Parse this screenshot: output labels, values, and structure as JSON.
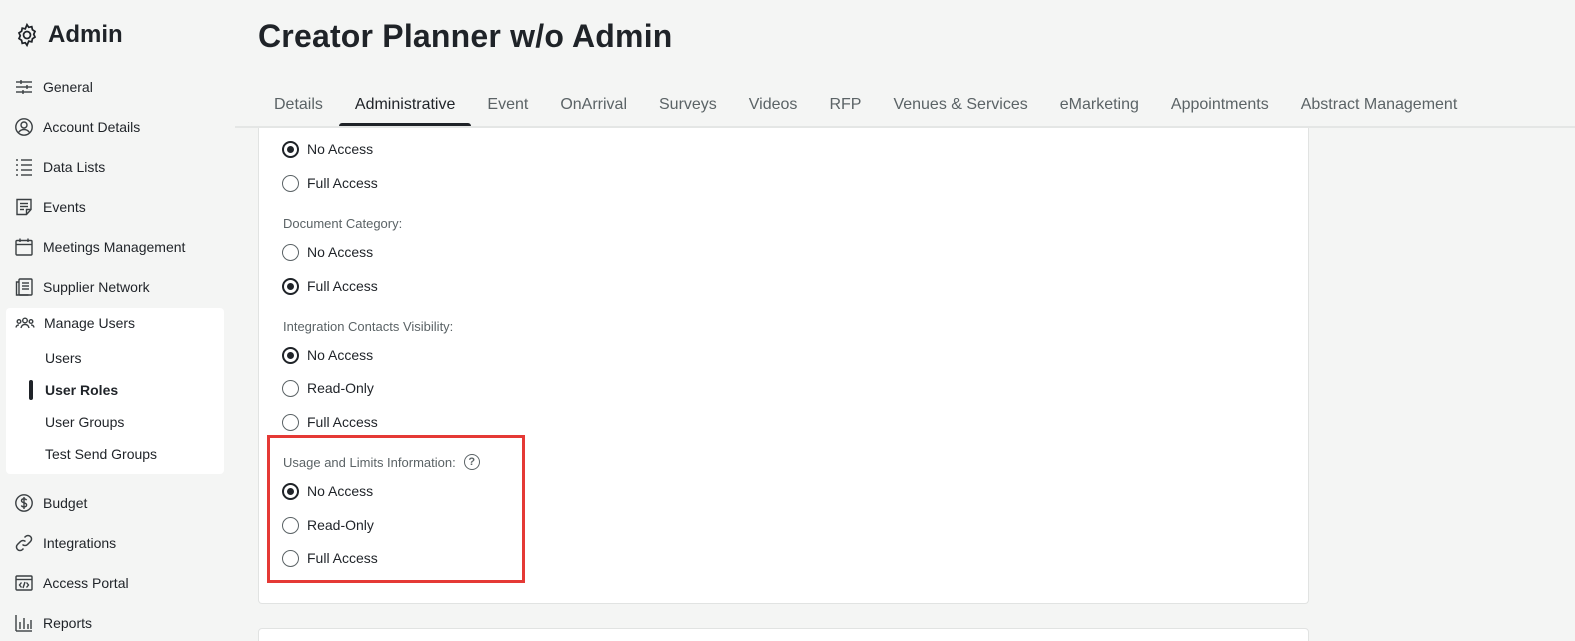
{
  "sidebar": {
    "title": "Admin",
    "items": [
      {
        "label": "General",
        "icon": "sliders-icon"
      },
      {
        "label": "Account Details",
        "icon": "user-circle-icon"
      },
      {
        "label": "Data Lists",
        "icon": "list-icon"
      },
      {
        "label": "Events",
        "icon": "event-note-icon"
      },
      {
        "label": "Meetings Management",
        "icon": "calendar-icon"
      },
      {
        "label": "Supplier Network",
        "icon": "supplier-doc-icon"
      },
      {
        "label": "Manage Users",
        "icon": "users-group-icon"
      },
      {
        "label": "Budget",
        "icon": "dollar-circle-icon"
      },
      {
        "label": "Integrations",
        "icon": "link-icon"
      },
      {
        "label": "Access Portal",
        "icon": "code-window-icon"
      },
      {
        "label": "Reports",
        "icon": "bar-chart-icon"
      }
    ],
    "manage_users_sub": [
      "Users",
      "User Roles",
      "User Groups",
      "Test Send Groups"
    ],
    "active_sub": "User Roles"
  },
  "header": {
    "title": "Creator Planner w/o Admin",
    "tabs": [
      "Details",
      "Administrative",
      "Event",
      "OnArrival",
      "Surveys",
      "Videos",
      "RFP",
      "Venues & Services",
      "eMarketing",
      "Appointments",
      "Abstract Management"
    ],
    "active_tab": "Administrative"
  },
  "permissions": {
    "top_group": {
      "options": [
        "No Access",
        "Full Access"
      ],
      "selected": "No Access"
    },
    "document_category": {
      "label": "Document Category:",
      "options": [
        "No Access",
        "Full Access"
      ],
      "selected": "Full Access"
    },
    "integration_contacts": {
      "label": "Integration Contacts Visibility:",
      "options": [
        "No Access",
        "Read-Only",
        "Full Access"
      ],
      "selected": "No Access"
    },
    "usage_limits": {
      "label": "Usage and Limits Information:",
      "help_icon": "?",
      "options": [
        "No Access",
        "Read-Only",
        "Full Access"
      ],
      "selected": "No Access"
    }
  },
  "colors": {
    "highlight": "#e53935",
    "text": "#1f2328",
    "muted": "#5b6366",
    "background": "#f4f5f4"
  }
}
